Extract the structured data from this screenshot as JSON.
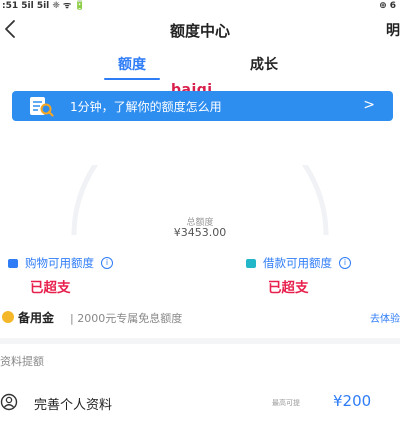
{
  "status_bar": {
    "time": ":51 5il 5il ❈ ᯤ 🔋",
    "right": "⊕ 6"
  },
  "navbar": {
    "title": "额度中心",
    "right_text": "明"
  },
  "tabs": [
    {
      "label": "额度",
      "active": true
    },
    {
      "label": "成长",
      "active": false
    }
  ],
  "watermark": "baiqi",
  "banner": {
    "text": "1分钟，了解你的额度怎么用",
    "arrow": ">"
  },
  "total": {
    "label": "总额度",
    "value": "¥3453.00"
  },
  "shopping": {
    "label": "购物可用额度",
    "info": "i",
    "value": "已超支"
  },
  "loan": {
    "label": "借款可用额度",
    "info": "i",
    "value": "已超支"
  },
  "reserve": {
    "title": "备用金",
    "desc": "| 2000元专属免息额度",
    "link": "去体验"
  },
  "section": {
    "title": "资料提额"
  },
  "task": {
    "label": "完善个人资料",
    "hint": "最高可提",
    "amount": "¥200"
  },
  "colors": {
    "accent": "#2e7cf6",
    "banner": "#2e8ef0",
    "alert": "#e8204d",
    "watermark": "#d81e4a",
    "reserve_coin": "#f5b72a"
  }
}
